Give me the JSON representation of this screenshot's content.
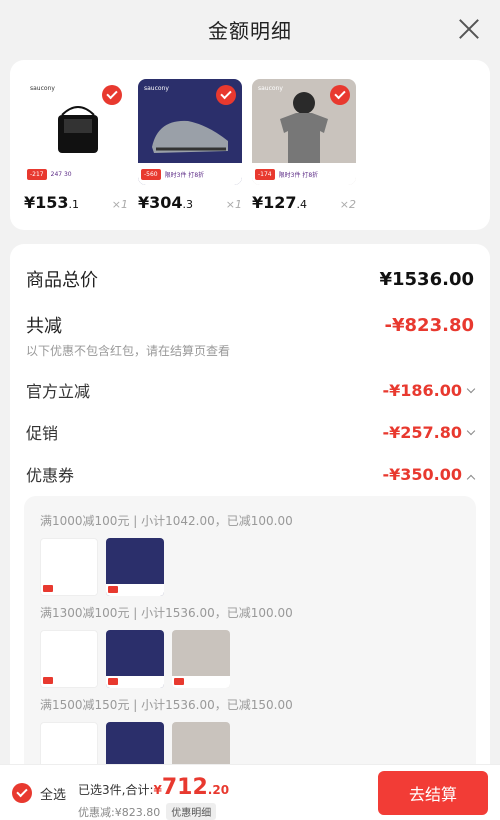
{
  "header": {
    "title": "金额明细"
  },
  "products": [
    {
      "brand": "saucony",
      "promo_tag": "-217",
      "promo_text": "247  30",
      "price_int": "¥153",
      "price_dec": ".1",
      "qty": "×1",
      "bg": "#ffffff"
    },
    {
      "brand": "saucony",
      "promo_tag": "-560",
      "promo_text": "限时3件 打8折",
      "price_int": "¥304",
      "price_dec": ".3",
      "qty": "×1",
      "bg": "#2b2f6b"
    },
    {
      "brand": "saucony",
      "promo_tag": "-174",
      "promo_text": "限时3件 打8折",
      "price_int": "¥127",
      "price_dec": ".4",
      "qty": "×2",
      "bg": "#c9c3bd"
    }
  ],
  "detail": {
    "total_label": "商品总价",
    "total_value": "¥1536.00",
    "reduce_label": "共减",
    "reduce_value": "-¥823.80",
    "note": "以下优惠不包含红包，请在结算页查看",
    "official_label": "官方立减",
    "official_value": "-¥186.00",
    "promo_label": "促销",
    "promo_value": "-¥257.80",
    "coupon_label": "优惠券",
    "coupon_value": "-¥350.00"
  },
  "coupons": [
    {
      "text": "满1000减100元 | 小计1042.00，已减100.00"
    },
    {
      "text": "满1300减100元 | 小计1536.00，已减100.00"
    },
    {
      "text": "满1500减150元 | 小计1536.00，已减150.00"
    }
  ],
  "bottom": {
    "select_all": "全选",
    "selected_text": "已选3件,合计:",
    "currency": "¥",
    "total_int": "712",
    "total_dec": ".20",
    "discount_text": "优惠减:¥823.80",
    "detail_badge": "优惠明细",
    "checkout": "去结算"
  },
  "colors": {
    "accent": "#e8392f",
    "checkout": "#f23c36"
  }
}
